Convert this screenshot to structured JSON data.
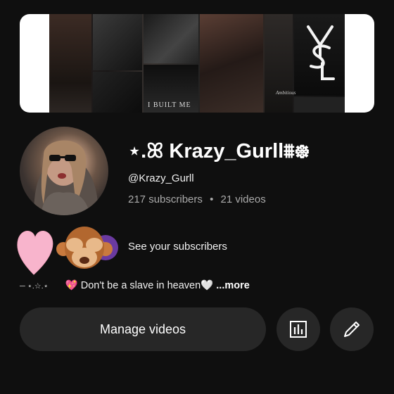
{
  "banner": {
    "collage_text": "I BUILT ME",
    "signature_text": "Ambitious",
    "logo_text": "YSL"
  },
  "channel": {
    "name": "⋆.ꕤ Krazy_Gurll⩩᪥",
    "handle": "@Krazy_Gurll",
    "subscribers": "217 subscribers",
    "separator": "•",
    "videos": "21 videos"
  },
  "subscribers_row": {
    "label": "See your subscribers",
    "emojis": [
      "heart-emoji",
      "see-no-evil-monkey-emoji"
    ]
  },
  "description": {
    "decoration": "─ ⋆.☆.⋆",
    "emoji": "💖",
    "text": "Don't be a slave in heaven🤍",
    "more": "...more"
  },
  "actions": {
    "manage_label": "Manage videos",
    "analytics_icon": "analytics-bar-chart-icon",
    "edit_icon": "pencil-edit-icon"
  },
  "colors": {
    "background": "#0f0f0f",
    "button": "#272727",
    "secondary_text": "#aaaaaa"
  }
}
